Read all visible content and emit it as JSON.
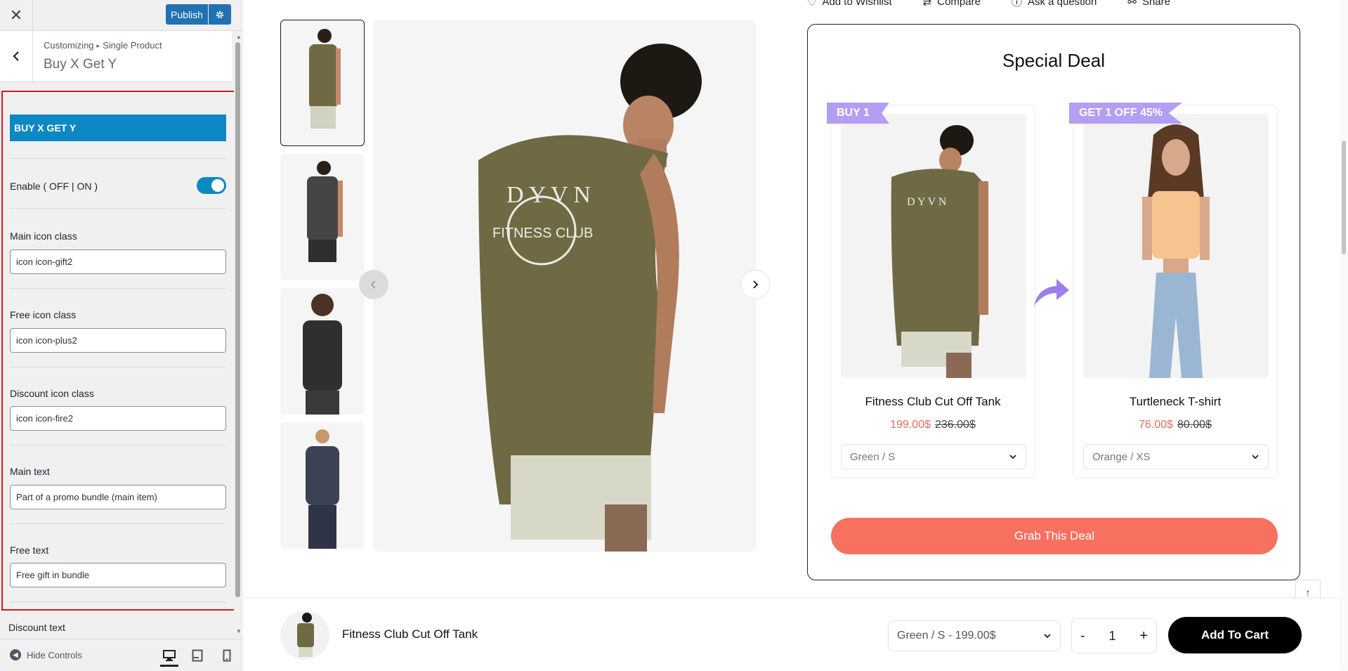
{
  "customizer": {
    "close_icon": "close-icon",
    "publish_label": "Publish",
    "breadcrumb": {
      "root": "Customizing",
      "section": "Single Product"
    },
    "section_title": "Buy X Get Y",
    "panel_heading": "BUY X GET Y",
    "enable": {
      "label": "Enable ( OFF | ON )",
      "state": "on"
    },
    "fields": {
      "main_icon": {
        "label": "Main icon class",
        "value": "icon icon-gift2"
      },
      "free_icon": {
        "label": "Free icon class",
        "value": "icon icon-plus2"
      },
      "discount_icon": {
        "label": "Discount icon class",
        "value": "icon icon-fire2"
      },
      "main_text": {
        "label": "Main text",
        "value": "Part of a promo bundle (main item)"
      },
      "free_text": {
        "label": "Free text",
        "value": "Free gift in bundle"
      }
    },
    "discount_text_label": "Discount text",
    "footer": {
      "hide_controls": "Hide Controls",
      "active_device": "desktop"
    },
    "accent_color": "#0c88c5",
    "highlight_border_color": "#d6191d"
  },
  "product_page": {
    "top_actions": [
      "Add to Wishlist",
      "Compare",
      "Ask a question",
      "Share"
    ],
    "gallery": {
      "thumbnails": [
        {
          "alt": "olive tank back view",
          "active": true
        },
        {
          "alt": "black tank side view",
          "active": false
        },
        {
          "alt": "black t-shirt curly hair",
          "active": false
        },
        {
          "alt": "navy t-shirt",
          "active": false
        }
      ]
    },
    "special_deal": {
      "title": "Special Deal",
      "items": [
        {
          "ribbon": "BUY 1",
          "name": "Fitness Club Cut Off Tank",
          "sale_price": "199.00$",
          "regular_price": "236.00$",
          "variant": "Green / S"
        },
        {
          "ribbon": "GET 1 OFF 45%",
          "name": "Turtleneck T-shirt",
          "sale_price": "76.00$",
          "regular_price": "80.00$",
          "variant": "Orange / XS"
        }
      ],
      "cta_label": "Grab This Deal",
      "cta_color": "#f87060",
      "ribbon_color": "#b39ef3"
    },
    "sticky_bar": {
      "product_name": "Fitness Club Cut Off Tank",
      "variant": "Green / S - 199.00$",
      "quantity": "1",
      "minus": "-",
      "plus": "+",
      "add_to_cart": "Add To Cart"
    }
  }
}
